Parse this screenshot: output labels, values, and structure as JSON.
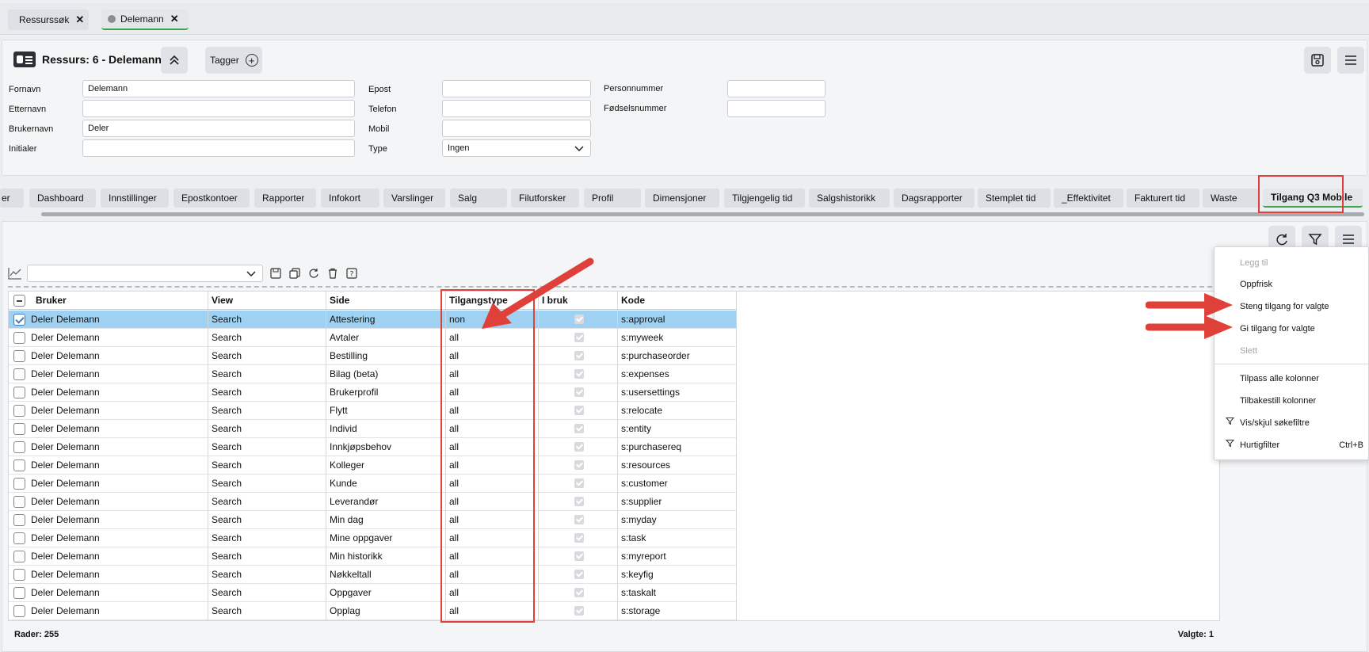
{
  "top_tabs": [
    {
      "label": "Ressurssøk",
      "active": false
    },
    {
      "label": "Delemann",
      "active": true
    }
  ],
  "header": {
    "title": "Ressurs: 6 - Delemann",
    "tagger_label": "Tagger"
  },
  "form": {
    "fornavn_label": "Fornavn",
    "fornavn_value": "Delemann",
    "etternavn_label": "Etternavn",
    "etternavn_value": "",
    "brukernavn_label": "Brukernavn",
    "brukernavn_value": "Deler",
    "initialer_label": "Initialer",
    "initialer_value": "",
    "epost_label": "Epost",
    "epost_value": "",
    "telefon_label": "Telefon",
    "telefon_value": "",
    "mobil_label": "Mobil",
    "mobil_value": "",
    "type_label": "Type",
    "type_value": "Ingen",
    "personnummer_label": "Personnummer",
    "personnummer_value": "",
    "fodselsnummer_label": "Fødselsnummer",
    "fodselsnummer_value": ""
  },
  "sub_tabs": [
    "er",
    "Dashboard",
    "Innstillinger",
    "Epostkontoer",
    "Rapporter",
    "Infokort",
    "Varslinger",
    "Salg",
    "Filutforsker",
    "Profil",
    "Dimensjoner",
    "Tilgjengelig tid",
    "Salgshistorikk",
    "Dagsrapporter",
    "Stemplet tid",
    "_Effektivitet",
    "Fakturert tid",
    "Waste",
    "Tilgang Q3 Mobile"
  ],
  "grid": {
    "columns": [
      "Bruker",
      "View",
      "Side",
      "Tilgangstype",
      "I bruk",
      "Kode"
    ],
    "rows": [
      {
        "bruker": "Deler Delemann",
        "view": "Search",
        "side": "Attestering",
        "tilgangstype": "non",
        "kode": "s:approval",
        "selected": true
      },
      {
        "bruker": "Deler Delemann",
        "view": "Search",
        "side": "Avtaler",
        "tilgangstype": "all",
        "kode": "s:myweek"
      },
      {
        "bruker": "Deler Delemann",
        "view": "Search",
        "side": "Bestilling",
        "tilgangstype": "all",
        "kode": "s:purchaseorder"
      },
      {
        "bruker": "Deler Delemann",
        "view": "Search",
        "side": "Bilag (beta)",
        "tilgangstype": "all",
        "kode": "s:expenses"
      },
      {
        "bruker": "Deler Delemann",
        "view": "Search",
        "side": "Brukerprofil",
        "tilgangstype": "all",
        "kode": "s:usersettings"
      },
      {
        "bruker": "Deler Delemann",
        "view": "Search",
        "side": "Flytt",
        "tilgangstype": "all",
        "kode": "s:relocate"
      },
      {
        "bruker": "Deler Delemann",
        "view": "Search",
        "side": "Individ",
        "tilgangstype": "all",
        "kode": "s:entity"
      },
      {
        "bruker": "Deler Delemann",
        "view": "Search",
        "side": "Innkjøpsbehov",
        "tilgangstype": "all",
        "kode": "s:purchasereq"
      },
      {
        "bruker": "Deler Delemann",
        "view": "Search",
        "side": "Kolleger",
        "tilgangstype": "all",
        "kode": "s:resources"
      },
      {
        "bruker": "Deler Delemann",
        "view": "Search",
        "side": "Kunde",
        "tilgangstype": "all",
        "kode": "s:customer"
      },
      {
        "bruker": "Deler Delemann",
        "view": "Search",
        "side": "Leverandør",
        "tilgangstype": "all",
        "kode": "s:supplier"
      },
      {
        "bruker": "Deler Delemann",
        "view": "Search",
        "side": "Min dag",
        "tilgangstype": "all",
        "kode": "s:myday"
      },
      {
        "bruker": "Deler Delemann",
        "view": "Search",
        "side": "Mine oppgaver",
        "tilgangstype": "all",
        "kode": "s:task"
      },
      {
        "bruker": "Deler Delemann",
        "view": "Search",
        "side": "Min historikk",
        "tilgangstype": "all",
        "kode": "s:myreport"
      },
      {
        "bruker": "Deler Delemann",
        "view": "Search",
        "side": "Nøkkeltall",
        "tilgangstype": "all",
        "kode": "s:keyfig"
      },
      {
        "bruker": "Deler Delemann",
        "view": "Search",
        "side": "Oppgaver",
        "tilgangstype": "all",
        "kode": "s:taskalt"
      },
      {
        "bruker": "Deler Delemann",
        "view": "Search",
        "side": "Opplag",
        "tilgangstype": "all",
        "kode": "s:storage"
      }
    ]
  },
  "footer": {
    "rows": "Rader: 255",
    "selected": "Valgte: 1"
  },
  "context_menu": [
    {
      "label": "Legg til",
      "disabled": true
    },
    {
      "label": "Oppfrisk",
      "disabled": false
    },
    {
      "label": "Steng tilgang for valgte",
      "disabled": false
    },
    {
      "label": "Gi tilgang for valgte",
      "disabled": false
    },
    {
      "label": "Slett",
      "disabled": true
    },
    {
      "label": "Tilpass alle kolonner",
      "disabled": false
    },
    {
      "label": "Tilbakestill kolonner",
      "disabled": false
    },
    {
      "label": "Vis/skjul søkefiltre",
      "disabled": false,
      "icon": "filter-icon"
    },
    {
      "label": "Hurtigfilter",
      "disabled": false,
      "icon": "filter-icon",
      "shortcut": "Ctrl+B"
    }
  ],
  "colors": {
    "accent_green": "#3fa34d",
    "selection_blue": "#9fd1f3",
    "annotation_red": "#e0403a"
  }
}
